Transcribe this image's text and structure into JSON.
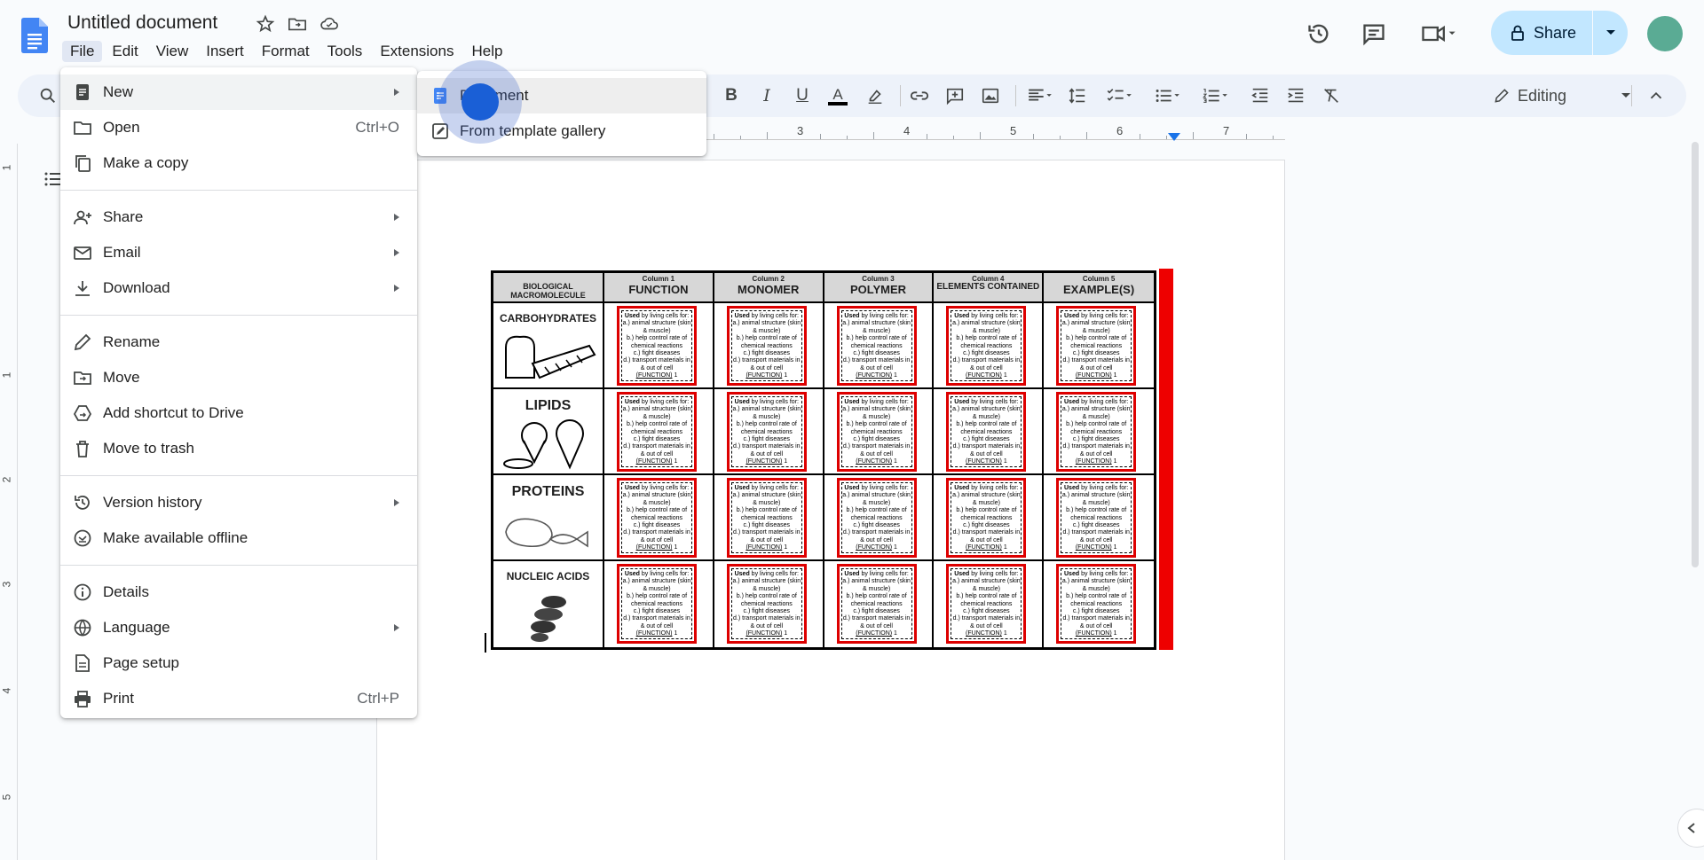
{
  "document": {
    "title": "Untitled document"
  },
  "menubar": {
    "items": [
      "File",
      "Edit",
      "View",
      "Insert",
      "Format",
      "Tools",
      "Extensions",
      "Help"
    ],
    "active_index": 0
  },
  "header": {
    "share_label": "Share"
  },
  "toolbar": {
    "bold": "B",
    "italic": "I",
    "underline": "U",
    "text_color": "A",
    "mode_label": "Editing"
  },
  "ruler": {
    "labels": [
      "3",
      "4",
      "5",
      "6",
      "7"
    ]
  },
  "vertical_ruler": {
    "labels": [
      "1",
      "1",
      "2",
      "3",
      "4",
      "5"
    ]
  },
  "file_menu": {
    "items": [
      {
        "label": "New",
        "icon": "document-icon",
        "submenu": true
      },
      {
        "label": "Open",
        "icon": "folder-icon",
        "shortcut": "Ctrl+O"
      },
      {
        "label": "Make a copy",
        "icon": "copy-icon"
      },
      {
        "label": "Share",
        "icon": "person-add-icon",
        "submenu": true
      },
      {
        "label": "Email",
        "icon": "email-icon",
        "submenu": true
      },
      {
        "label": "Download",
        "icon": "download-icon",
        "submenu": true
      },
      {
        "label": "Rename",
        "icon": "pencil-icon"
      },
      {
        "label": "Move",
        "icon": "move-folder-icon"
      },
      {
        "label": "Add shortcut to Drive",
        "icon": "drive-shortcut-icon"
      },
      {
        "label": "Move to trash",
        "icon": "trash-icon"
      },
      {
        "label": "Version history",
        "icon": "history-icon",
        "submenu": true
      },
      {
        "label": "Make available offline",
        "icon": "offline-icon"
      },
      {
        "label": "Details",
        "icon": "info-icon"
      },
      {
        "label": "Language",
        "icon": "globe-icon",
        "submenu": true
      },
      {
        "label": "Page setup",
        "icon": "page-icon"
      },
      {
        "label": "Print",
        "icon": "print-icon",
        "shortcut": "Ctrl+P"
      }
    ]
  },
  "new_submenu": {
    "items": [
      {
        "label": "Document",
        "icon": "document-icon"
      },
      {
        "label": "From template gallery",
        "icon": "template-icon"
      }
    ]
  },
  "worksheet": {
    "header_first": "BIOLOGICAL MACROMOLECULE",
    "columns": [
      {
        "small": "Column 1",
        "big": "FUNCTION"
      },
      {
        "small": "Column 2",
        "big": "MONOMER"
      },
      {
        "small": "Column 3",
        "big": "POLYMER"
      },
      {
        "small": "Column 4",
        "big": "ELEMENTS CONTAINED"
      },
      {
        "small": "Column 5",
        "big": "EXAMPLE(S)"
      }
    ],
    "rows": [
      "CARBOHYDRATES",
      "LIPIDS",
      "PROTEINS",
      "NUCLEIC ACIDS"
    ],
    "card": {
      "line1_bold": "Used",
      "line1_rest": " by living cells for:",
      "a": "a.) animal structure (skin & muscle)",
      "b": "b.) help control rate of chemical reactions",
      "c": "c.) fight diseases",
      "d": "d.) transport materials in & out of cell",
      "fn": "(FUNCTION)",
      "num": "1"
    }
  },
  "colors": {
    "accent": "#1a73e8",
    "share_bg": "#c2e7ff",
    "avatar": "#5aab94",
    "card_border": "#dd0000"
  }
}
